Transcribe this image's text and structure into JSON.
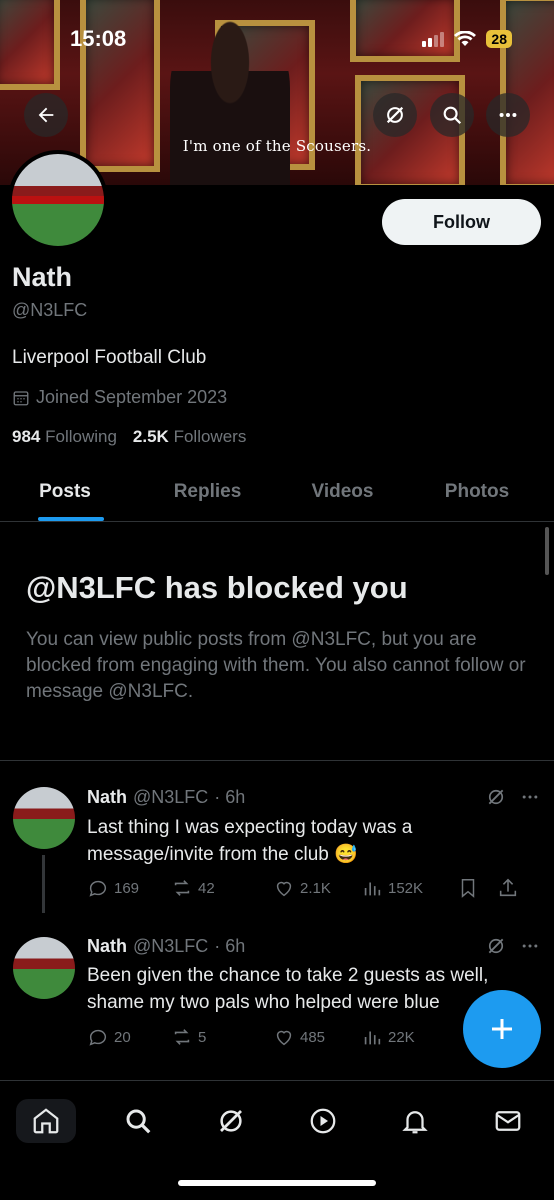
{
  "status_bar": {
    "time": "15:08",
    "battery": "28"
  },
  "banner": {
    "caption": "I'm one of the Scousers."
  },
  "icons": {
    "back": "arrow-left-icon",
    "grok": "grok-icon",
    "search": "search-icon",
    "more": "more-horizontal-icon"
  },
  "profile": {
    "name": "Nath",
    "handle": "@N3LFC",
    "bio": "Liverpool Football Club",
    "joined": "Joined September 2023",
    "following_count": "984",
    "following_label": "Following",
    "followers_count": "2.5K",
    "followers_label": "Followers",
    "follow_label": "Follow"
  },
  "tabs": [
    {
      "label": "Posts"
    },
    {
      "label": "Replies"
    },
    {
      "label": "Videos"
    },
    {
      "label": "Photos"
    }
  ],
  "blocked": {
    "title": "@N3LFC has blocked you",
    "description": "You can view public posts from @N3LFC, but you are blocked from engaging with them. You also cannot follow or message @N3LFC."
  },
  "posts": [
    {
      "name": "Nath",
      "handle": "@N3LFC",
      "time": "· 6h",
      "text": "Last thing I was expecting today was a message/invite from the club 😅",
      "replies": "169",
      "reposts": "42",
      "likes": "2.1K",
      "views": "152K"
    },
    {
      "name": "Nath",
      "handle": "@N3LFC",
      "time": "· 6h",
      "text": "Been given the chance to take 2 guests as well, shame my two pals who helped were blue",
      "replies": "20",
      "reposts": "5",
      "likes": "485",
      "views": "22K"
    }
  ],
  "colors": {
    "accent": "#1d9bf0",
    "muted": "#71767b",
    "text": "#e7e9ea",
    "background": "#000000"
  }
}
